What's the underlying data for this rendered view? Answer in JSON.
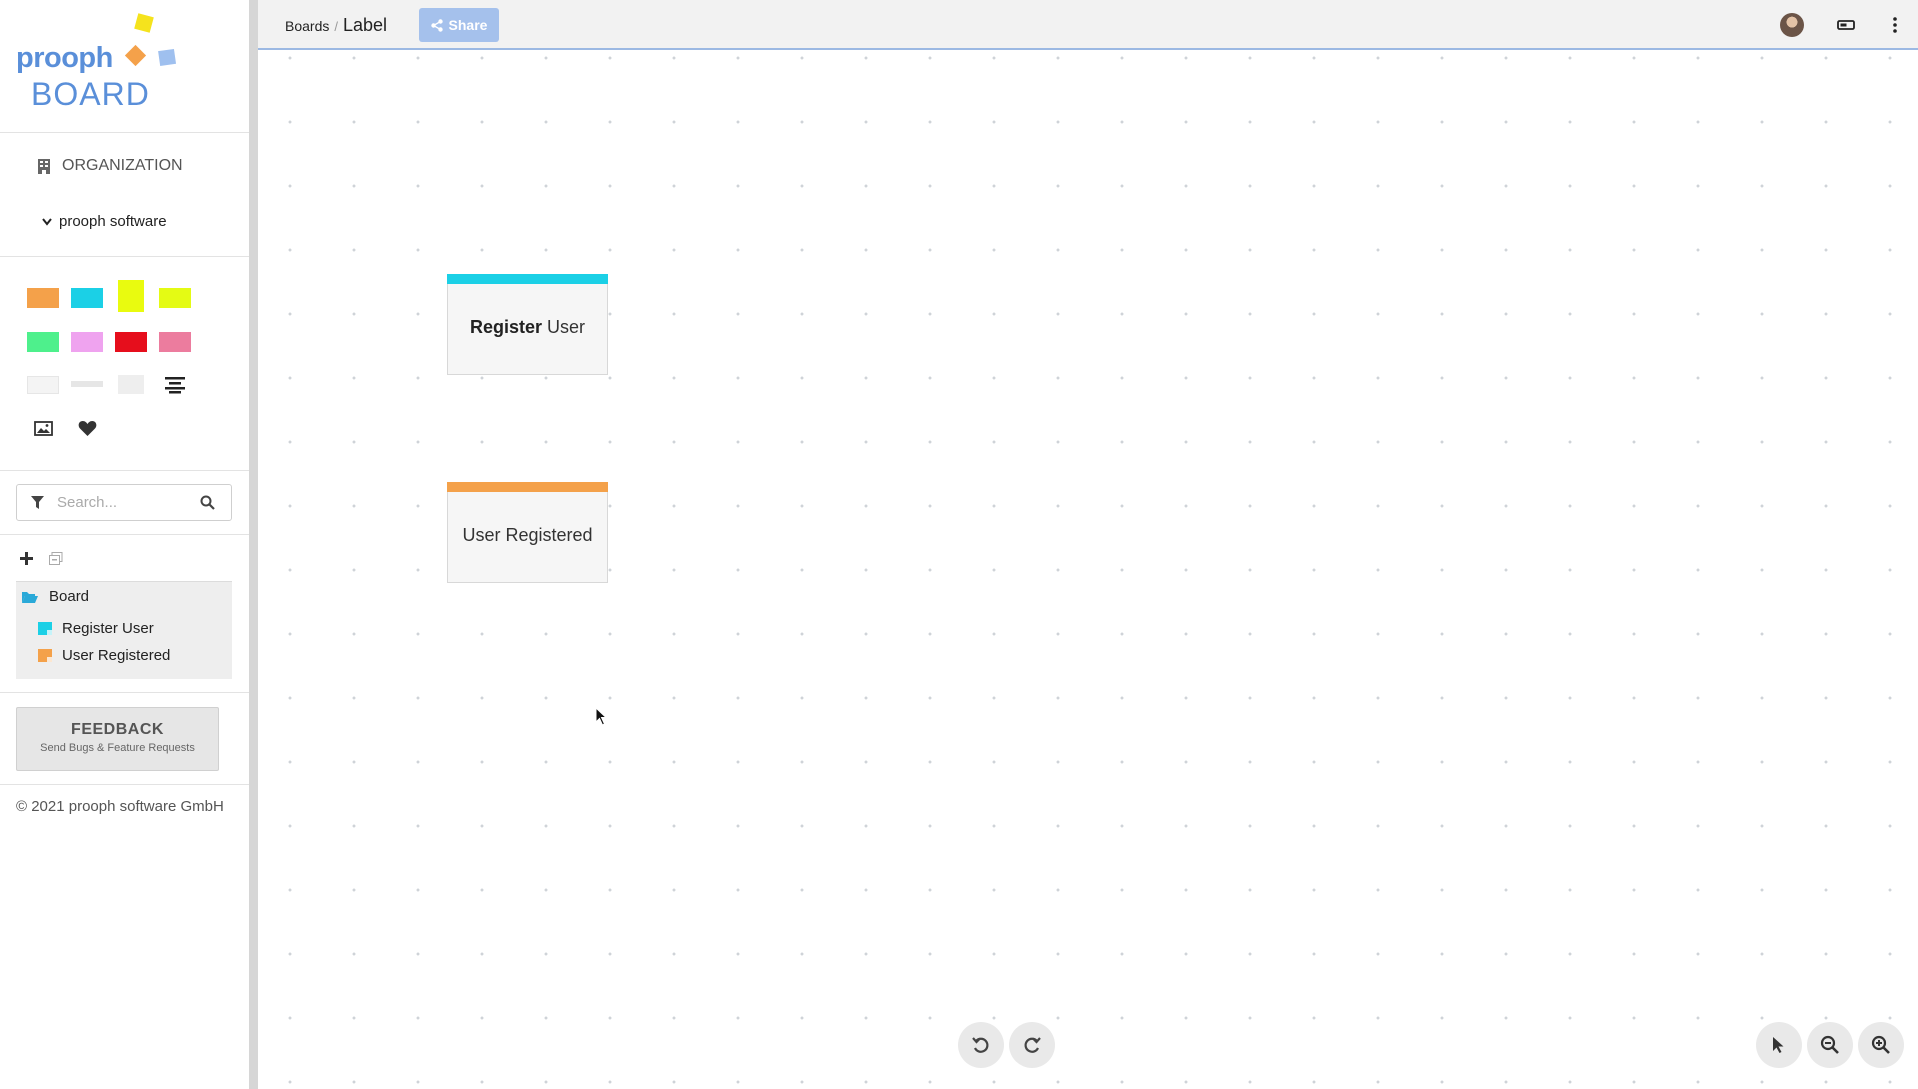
{
  "logo": {
    "line1": "prooph",
    "line2": "BOARD"
  },
  "organization": {
    "title": "ORGANIZATION",
    "item": "prooph software"
  },
  "palette": {
    "colors": [
      "#f4a14a",
      "#1bd0e6",
      "#e9fb0f",
      "#e4fb14",
      "#4ef08c",
      "#efa3ef",
      "#e60e1c",
      "#ec7c9e"
    ],
    "icons": [
      "text-element-icon",
      "line-element-icon",
      "box-element-icon",
      "text-align-icon",
      "image-icon",
      "heart-icon"
    ]
  },
  "search": {
    "placeholder": "Search..."
  },
  "tree": {
    "root": "Board",
    "items": [
      {
        "label": "Register User",
        "color": "#1bd0e6"
      },
      {
        "label": "User Registered",
        "color": "#f4a14a"
      }
    ]
  },
  "feedback": {
    "title": "FEEDBACK",
    "subtitle": "Send Bugs & Feature Requests"
  },
  "copyright": "© 2021 prooph software GmbH",
  "topbar": {
    "breadcrumb": "Boards",
    "separator": "/",
    "title": "Label",
    "share_label": "Share"
  },
  "canvas": {
    "cards": [
      {
        "bold": "Register",
        "rest": " User",
        "color": "#1bd0e6"
      },
      {
        "bold": "",
        "rest": "User Registered",
        "color": "#f4a14a"
      }
    ]
  }
}
